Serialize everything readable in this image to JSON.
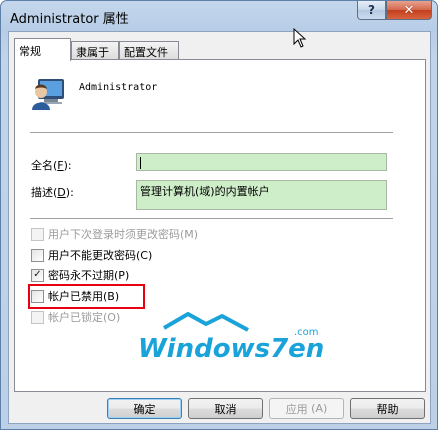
{
  "window": {
    "title": "Administrator 属性",
    "help_glyph": "?",
    "close_glyph": "✕"
  },
  "tabs": [
    {
      "label": "常规",
      "active": true
    },
    {
      "label": "隶属于",
      "active": false
    },
    {
      "label": "配置文件",
      "active": false
    }
  ],
  "user": {
    "name": "Administrator",
    "icon": "user-account-icon"
  },
  "fields": {
    "fullname": {
      "label_text": "全名",
      "label_key": "F",
      "label_suffix": ":",
      "value": ""
    },
    "description": {
      "label_text": "描述",
      "label_key": "D",
      "label_suffix": ":",
      "value": "管理计算机(域)的内置帐户"
    }
  },
  "checkboxes": [
    {
      "label": "用户下次登录时须更改密码",
      "key": "M",
      "checked": false,
      "disabled": true
    },
    {
      "label": "用户不能更改密码",
      "key": "C",
      "checked": false,
      "disabled": false
    },
    {
      "label": "密码永不过期",
      "key": "P",
      "checked": true,
      "disabled": false
    },
    {
      "label": "帐户已禁用",
      "key": "B",
      "checked": false,
      "disabled": false
    },
    {
      "label": "帐户已锁定",
      "key": "O",
      "checked": false,
      "disabled": true
    }
  ],
  "logo": {
    "main": "Windows7en",
    "sub": ".com",
    "color": "#1aa3d8"
  },
  "buttons": {
    "ok": "确定",
    "cancel": "取消",
    "apply": "应用",
    "apply_key": "A",
    "help": "帮助"
  },
  "colors": {
    "field_bg": "#ceeec9",
    "highlight": "#e60012",
    "close_button": "#c23f1e"
  }
}
